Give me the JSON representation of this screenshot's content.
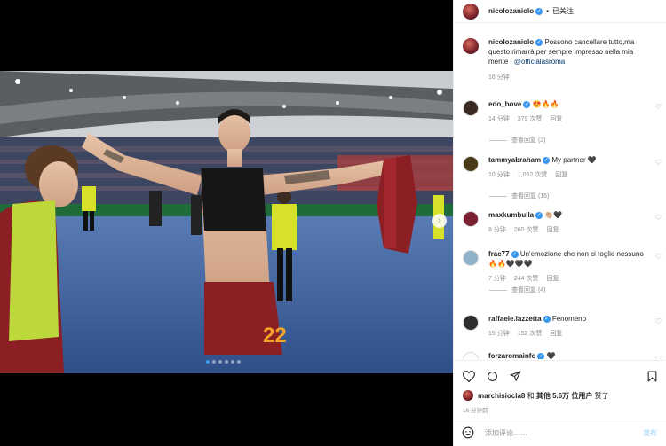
{
  "header": {
    "username": "nicolozaniolo",
    "separator": "•",
    "follow_status": "已关注"
  },
  "caption": {
    "username": "nicolozaniolo",
    "text": "Possono cancellare tutto,ma questo rimarrà per sempre impresso nella mia mente !",
    "mention": "@officialasroma",
    "time": "16 分钟"
  },
  "comments": [
    {
      "username": "edo_bove",
      "text": "😍🔥🔥",
      "time": "14 分钟",
      "likes": "379 次赞",
      "reply": "回复",
      "view_replies": "查看回复 (2)",
      "avatar_color": "#3a2a22"
    },
    {
      "username": "tammyabraham",
      "text": "My partner 🖤",
      "time": "10 分钟",
      "likes": "1,052 次赞",
      "reply": "回复",
      "view_replies": "查看回复 (16)",
      "avatar_color": "#4a3a1a"
    },
    {
      "username": "maxkumbulla",
      "text": "👏🏼🖤",
      "time": "8 分钟",
      "likes": "260 次赞",
      "reply": "回复",
      "view_replies": "",
      "avatar_color": "#7a2030"
    },
    {
      "username": "frac77",
      "text": "Un'emozione che non ci toglie nessuno 🔥🔥🖤🖤🖤",
      "time": "7 分钟",
      "likes": "244 次赞",
      "reply": "回复",
      "view_replies": "查看回复 (4)",
      "avatar_color": "#8fb2c8"
    },
    {
      "username": "raffaele.iazzetta",
      "text": "Fenomeno",
      "time": "15 分钟",
      "likes": "192 次赞",
      "reply": "回复",
      "view_replies": "",
      "avatar_color": "#2e2e2e"
    },
    {
      "username": "forzaromainfo",
      "text": "🖤",
      "time": "",
      "likes": "",
      "reply": "",
      "view_replies": "",
      "avatar_color": "#ffffff"
    }
  ],
  "likes": {
    "liker": "marchisiocla8",
    "connector": "和",
    "others": "其他 5.6万 位用户",
    "suffix": "赞了"
  },
  "post_time": "16 分钟前",
  "add_comment": {
    "placeholder": "添加评论……",
    "post_label": "发布"
  },
  "carousel": {
    "dot_count": 6,
    "active_index": 0
  },
  "colors": {
    "verified": "#3897f0",
    "jersey": "#8b1f24",
    "accent_gold": "#f2a32a"
  }
}
